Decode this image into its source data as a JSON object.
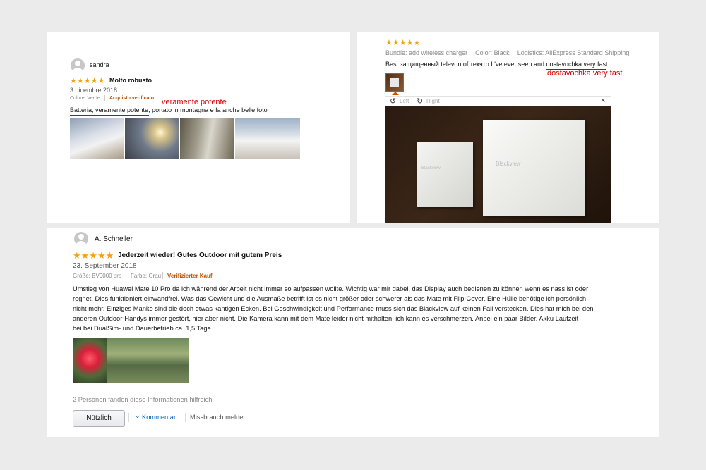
{
  "review1": {
    "user": "sandra",
    "stars": "★★★★★",
    "title": "Molto robusto",
    "date": "3 dicembre 2018",
    "meta_color": "Colore: Verde",
    "meta_verified": "Acquisto verificato",
    "body": "Batteria, veramente potente, portato in montagna e fa anche belle foto",
    "annotation": "veramente potente",
    "images": [
      "snowy-ridge-photo",
      "sunset-mountains-photo",
      "forest-hiker-photo",
      "snowy-peak-photo"
    ]
  },
  "review2": {
    "stars": "★★★★★",
    "bundle_label": "Bundle:",
    "bundle_value": "add wireless charger",
    "color_label": "Color:",
    "color_value": "Black",
    "logistics_label": "Logistics:",
    "logistics_value": "AliExpress Standard Shipping",
    "body_prefix": "Best защищенный televon of техчто I 've ever seen and ",
    "body_highlight": "dostavochka very fast",
    "annotation": "dostavochka very fast",
    "viewer_left": "Left",
    "viewer_right": "Right",
    "viewer_close": "×",
    "box_brand": "Blackview"
  },
  "review3": {
    "user": "A. Schneller",
    "stars": "★★★★★",
    "title": "Jederzeit wieder! Gutes Outdoor mit gutem Preis",
    "date": "23. September 2018",
    "meta_size": "Größe: BV9000 pro",
    "meta_color": "Farbe: Grau",
    "meta_verified": "Verifizierter Kauf",
    "body_lines": [
      "Umstieg von Huawei Mate 10 Pro da ich während der Arbeit nicht immer so aufpassen wollte. Wichtig war mir dabei, das Display auch bedienen zu können wenn es nass ist oder",
      "regnet. Dies funktioniert einwandfrei. Was das Gewicht und die Ausmaße betrifft ist es nicht größer oder schwerer als das Mate mit Flip-Cover. Eine Hülle benötige ich persönlich",
      "nicht mehr. Einziges Manko sind die doch etwas kantigen Ecken. Bei Geschwindigkeit und Performance muss sich das Blackview auf keinen Fall verstecken. Dies hat mich bei den",
      "anderen Outdoor-Handys immer gestört, hier aber nicht. Die Kamera kann mit dem Mate leider nicht mithalten, ich kann es verschmerzen. Anbei ein paar Bilder. Akku Laufzeit",
      "bei bei DualSim- und Dauerbetrieb ca. 1,5 Tage."
    ],
    "helpful": "2 Personen fanden diese Informationen hilfreich",
    "useful_button": "Nützlich",
    "comment_link": "Kommentar",
    "report_link": "Missbrauch melden"
  }
}
